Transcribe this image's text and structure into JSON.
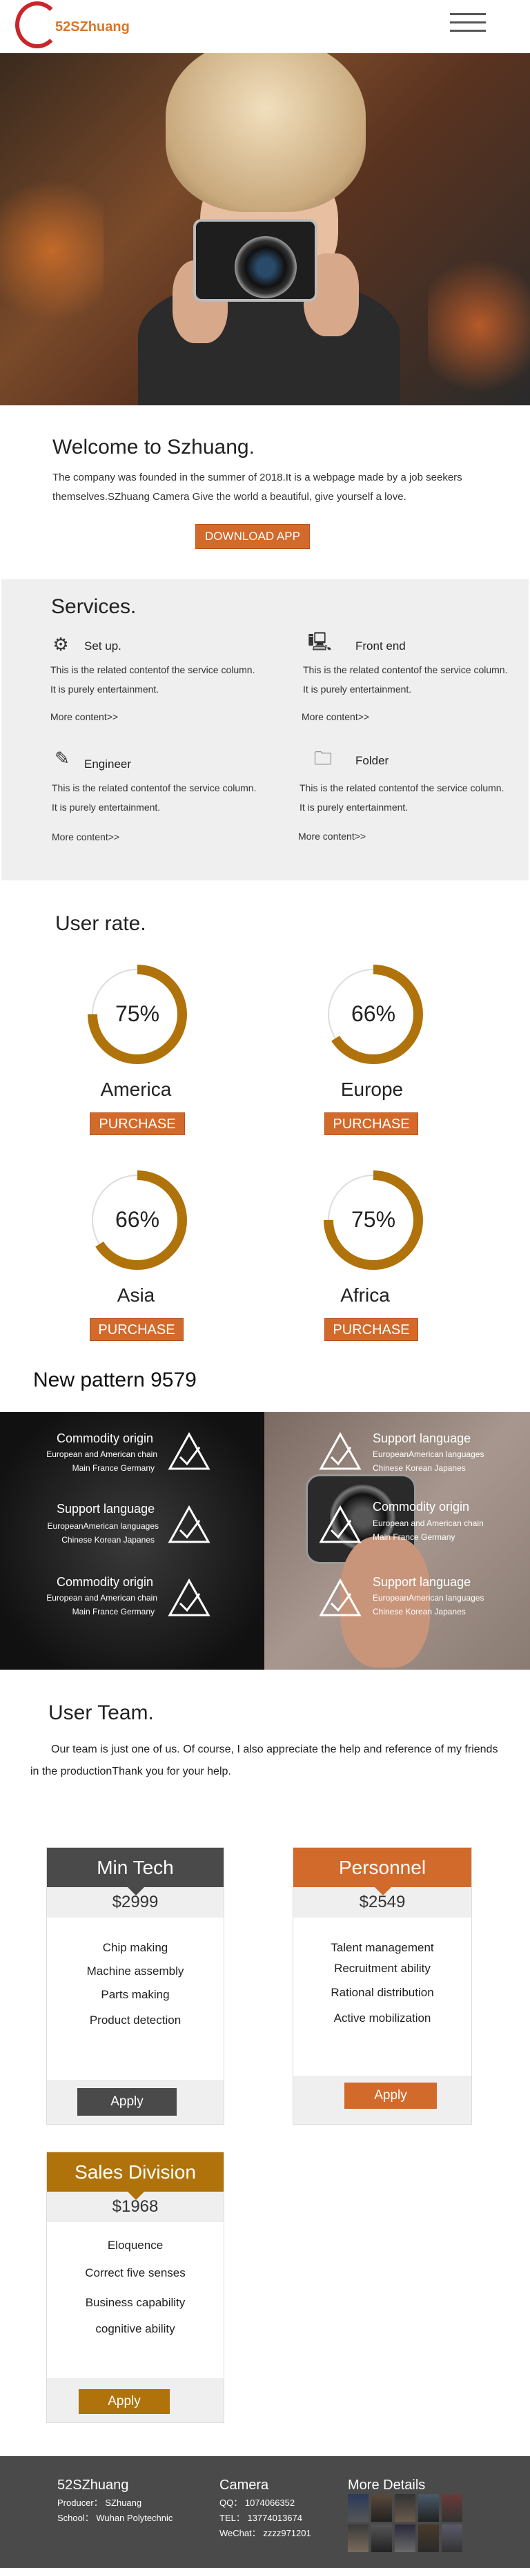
{
  "header": {
    "logo_text": "52SZhuang",
    "menu_icon": "hamburger-icon"
  },
  "welcome": {
    "title": "Welcome to Szhuang.",
    "text": "The company was founded in the summer of 2018.It is a webpage made by a job seekers themselves.SZhuang Camera Give the world a beautiful, give yourself a love.",
    "download_label": "DOWNLOAD APP"
  },
  "services": {
    "title": "Services.",
    "items": [
      {
        "icon": "gear-icon",
        "name": "Set up.",
        "desc": "This is the related contentof the service column. It is purely entertainment.",
        "more": "More content>>"
      },
      {
        "icon": "monitor-icon",
        "name": "Front end",
        "desc": "This is the related contentof the service column. It is purely entertainment.",
        "more": "More content>>"
      },
      {
        "icon": "edit-icon",
        "name": "Engineer",
        "desc": "This is the related contentof the service column. It is purely entertainment.",
        "more": "More content>>"
      },
      {
        "icon": "folder-icon",
        "name": "Folder",
        "desc": "This is the related contentof the service column. It is purely entertainment.",
        "more": "More content>>"
      }
    ]
  },
  "rate": {
    "title": "User rate.",
    "items": [
      {
        "region": "America",
        "percent": 75,
        "percent_label": "75%",
        "button": "PURCHASE"
      },
      {
        "region": "Europe",
        "percent": 66,
        "percent_label": "66%",
        "button": "PURCHASE"
      },
      {
        "region": "Asia",
        "percent": 66,
        "percent_label": "66%",
        "button": "PURCHASE"
      },
      {
        "region": "Africa",
        "percent": 75,
        "percent_label": "75%",
        "button": "PURCHASE"
      }
    ],
    "ring_color": "#b0720a",
    "track_color": "#dddddd"
  },
  "pattern": {
    "title": "New pattern 9579",
    "left": [
      {
        "heading": "Commodity origin",
        "line1": "European and American chain",
        "line2": "Main France Germany"
      },
      {
        "heading": "Support language",
        "line1": "EuropeanAmerican languages",
        "line2": "Chinese Korean Japanes"
      },
      {
        "heading": "Commodity origin",
        "line1": "European and American chain",
        "line2": "Main France Germany"
      }
    ],
    "right": [
      {
        "heading": "Support language",
        "line1": "EuropeanAmerican languages",
        "line2": "Chinese Korean Japanes"
      },
      {
        "heading": "Commodity origin",
        "line1": "European and American chain",
        "line2": "Main France Germany"
      },
      {
        "heading": "Support language",
        "line1": "EuropeanAmerican languages",
        "line2": "Chinese Korean Japanes"
      }
    ]
  },
  "team": {
    "title": "User Team.",
    "text": "Our team is just one of us. Of course, I also appreciate the help and reference of my friends in the productionThank you for your help.",
    "cards": [
      {
        "name": "Min Tech",
        "price": "$2999",
        "items": [
          "Chip making",
          "Machine assembly",
          "Parts making",
          "Product detection"
        ],
        "button": "Apply",
        "color": "#4a4a4a"
      },
      {
        "name": "Personnel",
        "price": "$2549",
        "items": [
          "Talent management",
          "Recruitment ability",
          "Rational distribution",
          "Active mobilization"
        ],
        "button": "Apply",
        "color": "#d26a2c"
      },
      {
        "name": "Sales Division",
        "price": "$1968",
        "items": [
          "Eloquence",
          "Correct five senses",
          "Business capability",
          "cognitive ability"
        ],
        "button": "Apply",
        "color": "#b0720a"
      }
    ]
  },
  "footer": {
    "col1": {
      "title": "52SZhuang",
      "line1": "Producer： SZhuang",
      "line2": "School： Wuhan Polytechnic"
    },
    "col2": {
      "title": "Camera",
      "line1": "QQ： 1074066352",
      "line2": "TEL： 13774013674",
      "line3": "WeChat： zzzz971201"
    },
    "col3": {
      "title": "More Details"
    }
  }
}
